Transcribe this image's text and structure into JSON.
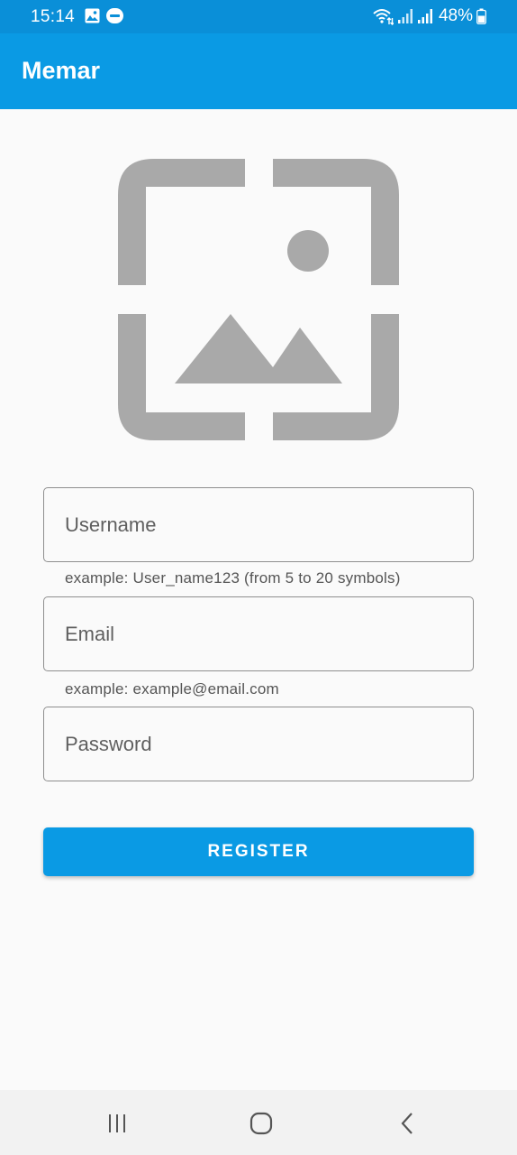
{
  "status_bar": {
    "time": "15:14",
    "battery": "48%",
    "icons": [
      "gallery-icon",
      "memar-app-icon",
      "wifi-icon",
      "signal-icon",
      "signal-icon",
      "battery-icon"
    ]
  },
  "app_bar": {
    "title": "Memar"
  },
  "hero": {
    "icon": "image-placeholder-icon",
    "color": "#a9a9a9"
  },
  "form": {
    "username": {
      "placeholder": "Username",
      "value": "",
      "helper": "example: User_name123 (from 5 to 20 symbols)"
    },
    "email": {
      "placeholder": "Email",
      "value": "",
      "helper": "example: example@email.com"
    },
    "password": {
      "placeholder": "Password",
      "value": ""
    },
    "register_label": "REGISTER"
  },
  "nav_bar": {
    "buttons": [
      "recent-apps-icon",
      "home-icon",
      "back-icon"
    ]
  },
  "colors": {
    "primary": "#0a9ae4",
    "status_bar": "#0a8fd8",
    "background": "#fafafa"
  }
}
